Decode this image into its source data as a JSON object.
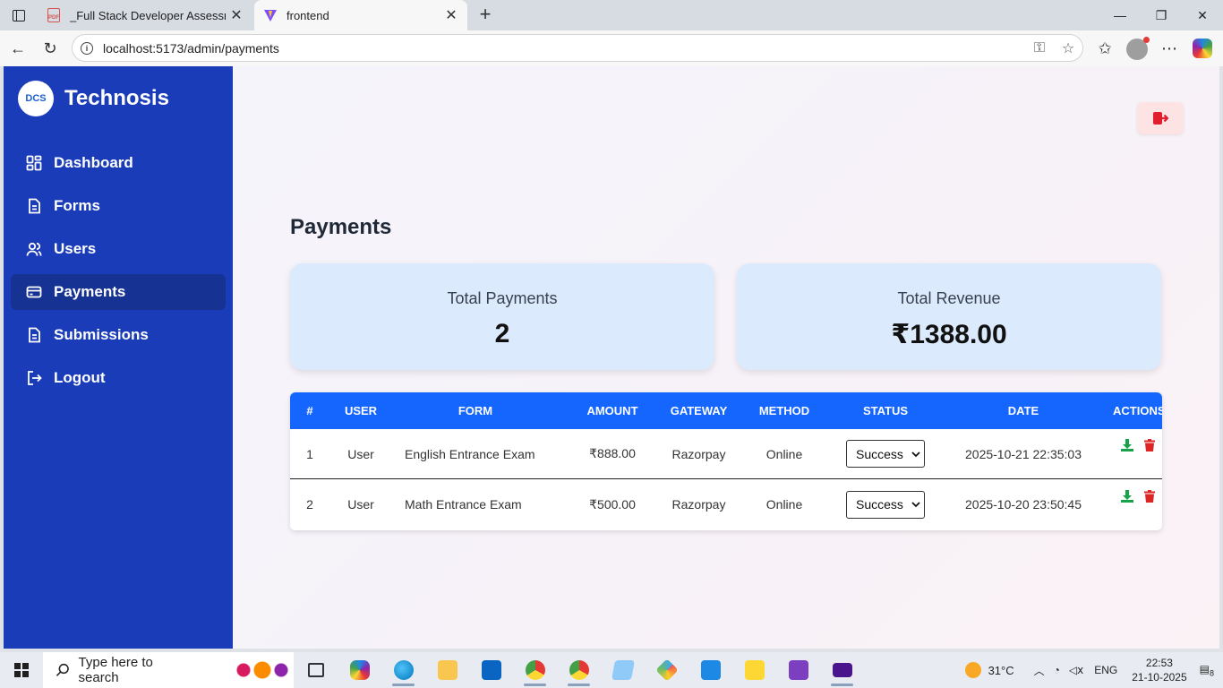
{
  "browser": {
    "tabs": [
      {
        "title": "_Full Stack Developer Assessment",
        "icon": "pdf-icon"
      },
      {
        "title": "frontend",
        "icon": "vite-icon"
      }
    ],
    "url": "localhost:5173/admin/payments"
  },
  "sidebar": {
    "brand_logo_text": "DCS",
    "brand_name": "Technosis",
    "items": [
      {
        "label": "Dashboard",
        "icon": "dashboard-icon",
        "active": false
      },
      {
        "label": "Forms",
        "icon": "document-icon",
        "active": false
      },
      {
        "label": "Users",
        "icon": "users-icon",
        "active": false
      },
      {
        "label": "Payments",
        "icon": "card-icon",
        "active": true
      },
      {
        "label": "Submissions",
        "icon": "document-icon",
        "active": false
      },
      {
        "label": "Logout",
        "icon": "logout-icon",
        "active": false
      }
    ]
  },
  "main": {
    "title": "Payments",
    "stats": [
      {
        "label": "Total Payments",
        "value": "2"
      },
      {
        "label": "Total Revenue",
        "value": "₹1388.00"
      }
    ],
    "table": {
      "headers": [
        "#",
        "USER",
        "FORM",
        "AMOUNT",
        "GATEWAY",
        "METHOD",
        "STATUS",
        "DATE",
        "ACTIONS"
      ],
      "rows": [
        {
          "num": "1",
          "user": "User",
          "form": "English Entrance Exam",
          "amount": "₹888.00",
          "gateway": "Razorpay",
          "method": "Online",
          "status": "Success",
          "date": "2025-10-21 22:35:03"
        },
        {
          "num": "2",
          "user": "User",
          "form": "Math Entrance Exam",
          "amount": "₹500.00",
          "gateway": "Razorpay",
          "method": "Online",
          "status": "Success",
          "date": "2025-10-20 23:50:45"
        }
      ]
    }
  },
  "taskbar": {
    "search_placeholder": "Type here to search",
    "temperature": "31°C",
    "language": "ENG",
    "time": "22:53",
    "date": "21-10-2025",
    "notification_count": "8"
  },
  "colors": {
    "sidebar_bg": "#1a3cb8",
    "sidebar_active": "#163293",
    "table_header": "#1565ff",
    "card_bg": "#dceafd",
    "download_green": "#16a34a",
    "delete_red": "#dc2626"
  }
}
